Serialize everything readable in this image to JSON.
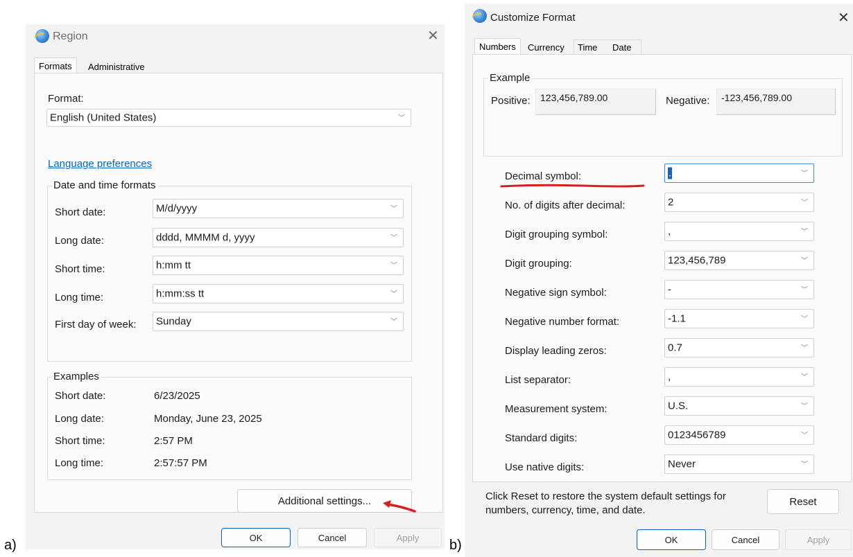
{
  "panel_labels": {
    "a": "a)",
    "b": "b)"
  },
  "region_dialog": {
    "title": "Region",
    "close_glyph": "✕",
    "tabs": [
      {
        "label": "Formats",
        "active": true
      },
      {
        "label": "Administrative",
        "active": false
      }
    ],
    "format_label": "Format:",
    "format_value": "English (United States)",
    "language_link": "Language preferences",
    "date_time_group": {
      "title": "Date and time formats",
      "rows": [
        {
          "label": "Short date:",
          "value": "M/d/yyyy"
        },
        {
          "label": "Long date:",
          "value": "dddd, MMMM d, yyyy"
        },
        {
          "label": "Short time:",
          "value": "h:mm tt"
        },
        {
          "label": "Long time:",
          "value": "h:mm:ss tt"
        },
        {
          "label": "First day of week:",
          "value": "Sunday"
        }
      ]
    },
    "examples_group": {
      "title": "Examples",
      "rows": [
        {
          "label": "Short date:",
          "value": "6/23/2025"
        },
        {
          "label": "Long date:",
          "value": "Monday, June 23, 2025"
        },
        {
          "label": "Short time:",
          "value": "2:57 PM"
        },
        {
          "label": "Long time:",
          "value": "2:57:57 PM"
        }
      ]
    },
    "additional_settings_button": "Additional settings...",
    "buttons": {
      "ok": "OK",
      "cancel": "Cancel",
      "apply": "Apply"
    }
  },
  "customize_dialog": {
    "title": "Customize Format",
    "close_glyph": "✕",
    "tabs": [
      {
        "label": "Numbers",
        "active": true
      },
      {
        "label": "Currency",
        "active": false
      },
      {
        "label": "Time",
        "active": false
      },
      {
        "label": "Date",
        "active": false
      }
    ],
    "example_group": {
      "title": "Example",
      "positive_label": "Positive:",
      "positive_value": "123,456,789.00",
      "negative_label": "Negative:",
      "negative_value": "-123,456,789.00"
    },
    "settings": [
      {
        "label": "Decimal symbol:",
        "value": "."
      },
      {
        "label": "No. of digits after decimal:",
        "value": "2"
      },
      {
        "label": "Digit grouping symbol:",
        "value": ","
      },
      {
        "label": "Digit grouping:",
        "value": "123,456,789"
      },
      {
        "label": "Negative sign symbol:",
        "value": "-"
      },
      {
        "label": "Negative number format:",
        "value": "-1.1"
      },
      {
        "label": "Display leading zeros:",
        "value": "0.7"
      },
      {
        "label": "List separator:",
        "value": ","
      },
      {
        "label": "Measurement system:",
        "value": "U.S."
      },
      {
        "label": "Standard digits:",
        "value": "0123456789"
      },
      {
        "label": "Use native digits:",
        "value": "Never"
      }
    ],
    "reset_text": "Click Reset to restore the system default settings for numbers, currency, time, and date.",
    "reset_button": "Reset",
    "buttons": {
      "ok": "OK",
      "cancel": "Cancel",
      "apply": "Apply"
    }
  },
  "colors": {
    "annotation_red": "#d62020",
    "link_blue": "#0067c0",
    "dialog_bg": "#f3f3f3",
    "page_bg": "#fbfbfb"
  }
}
